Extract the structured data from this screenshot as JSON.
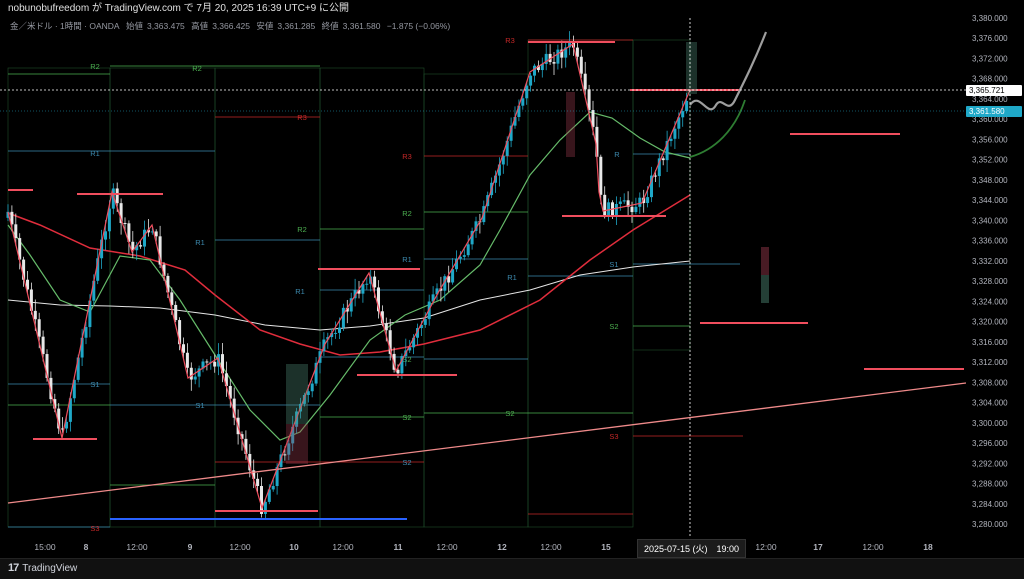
{
  "header": {
    "caption": "nobunobufreedom が TradingView.com で 7月 20, 2025 16:39 UTC+9 に公開"
  },
  "symbol": {
    "name": "金／米ドル · 1時間 · OANDA",
    "open_label": "始値",
    "open": "3,363.475",
    "high_label": "高値",
    "high": "3,366.425",
    "low_label": "安値",
    "low": "3,361.285",
    "close_label": "終値",
    "close": "3,361.580",
    "change": "−1.875 (−0.06%)"
  },
  "price_labels": {
    "crosshair": "3,365.721",
    "last": "3,361.580"
  },
  "date_label": "2025-07-15 (火)　19:00",
  "footer": {
    "brand": "TradingView"
  },
  "chart_data": {
    "type": "candlestick",
    "y_ticks": [
      "3,380.000",
      "3,376.000",
      "3,372.000",
      "3,368.000",
      "3,364.000",
      "3,360.000",
      "3,356.000",
      "3,352.000",
      "3,348.000",
      "3,344.000",
      "3,340.000",
      "3,336.000",
      "3,332.000",
      "3,328.000",
      "3,324.000",
      "3,320.000",
      "3,316.000",
      "3,312.000",
      "3,308.000",
      "3,304.000",
      "3,300.000",
      "3,296.000",
      "3,292.000",
      "3,288.000",
      "3,284.000",
      "3,280.000"
    ],
    "ylim": [
      3278,
      3381
    ],
    "x_ticks": [
      "15:00",
      "8",
      "12:00",
      "9",
      "12:00",
      "10",
      "12:00",
      "11",
      "12:00",
      "12",
      "12:00",
      "15",
      "12:00",
      "17",
      "12:00",
      "18"
    ],
    "pivot_labels": [
      {
        "label": "R2",
        "price": 3369.5,
        "color": "#4caf50"
      },
      {
        "label": "R2",
        "price": 3369.2,
        "color": "#4caf50"
      },
      {
        "label": "R1",
        "price": 3354.5,
        "color": "#3d8bb0"
      },
      {
        "label": "R3",
        "price": 3360.8,
        "color": "#c62828"
      },
      {
        "label": "R1",
        "price": 3336.0,
        "color": "#3d8bb0"
      },
      {
        "label": "R2",
        "price": 3338.6,
        "color": "#4caf50"
      },
      {
        "label": "R3",
        "price": 3352.3,
        "color": "#c62828"
      },
      {
        "label": "R2",
        "price": 3341.4,
        "color": "#4caf50"
      },
      {
        "label": "R1",
        "price": 3332.0,
        "color": "#3d8bb0"
      },
      {
        "label": "R1",
        "price": 3325.0,
        "color": "#3d8bb0"
      },
      {
        "label": "R1",
        "price": 3328.6,
        "color": "#3d8bb0"
      },
      {
        "label": "R3",
        "price": 3376.3,
        "color": "#c62828"
      },
      {
        "label": "R",
        "price": 3352.0,
        "color": "#3d8bb0"
      },
      {
        "label": "S1",
        "price": 3331.4,
        "color": "#3d8bb0"
      },
      {
        "label": "S1",
        "price": 3309.2,
        "color": "#3d8bb0"
      },
      {
        "label": "S1",
        "price": 3313.8,
        "color": "#3d8bb0"
      },
      {
        "label": "S2",
        "price": 3320.6,
        "color": "#4caf50"
      },
      {
        "label": "S2",
        "price": 3302.5,
        "color": "#4caf50"
      },
      {
        "label": "S2",
        "price": 3302.0,
        "color": "#4caf50"
      },
      {
        "label": "S2",
        "price": 3292.5,
        "color": "#4caf50"
      },
      {
        "label": "S2",
        "price": 3279.6,
        "color": "#3d8bb0"
      },
      {
        "label": "S3",
        "price": 3297.5,
        "color": "#c62828"
      },
      {
        "label": "S3",
        "price": 3282.0,
        "color": "#c62828"
      }
    ]
  }
}
